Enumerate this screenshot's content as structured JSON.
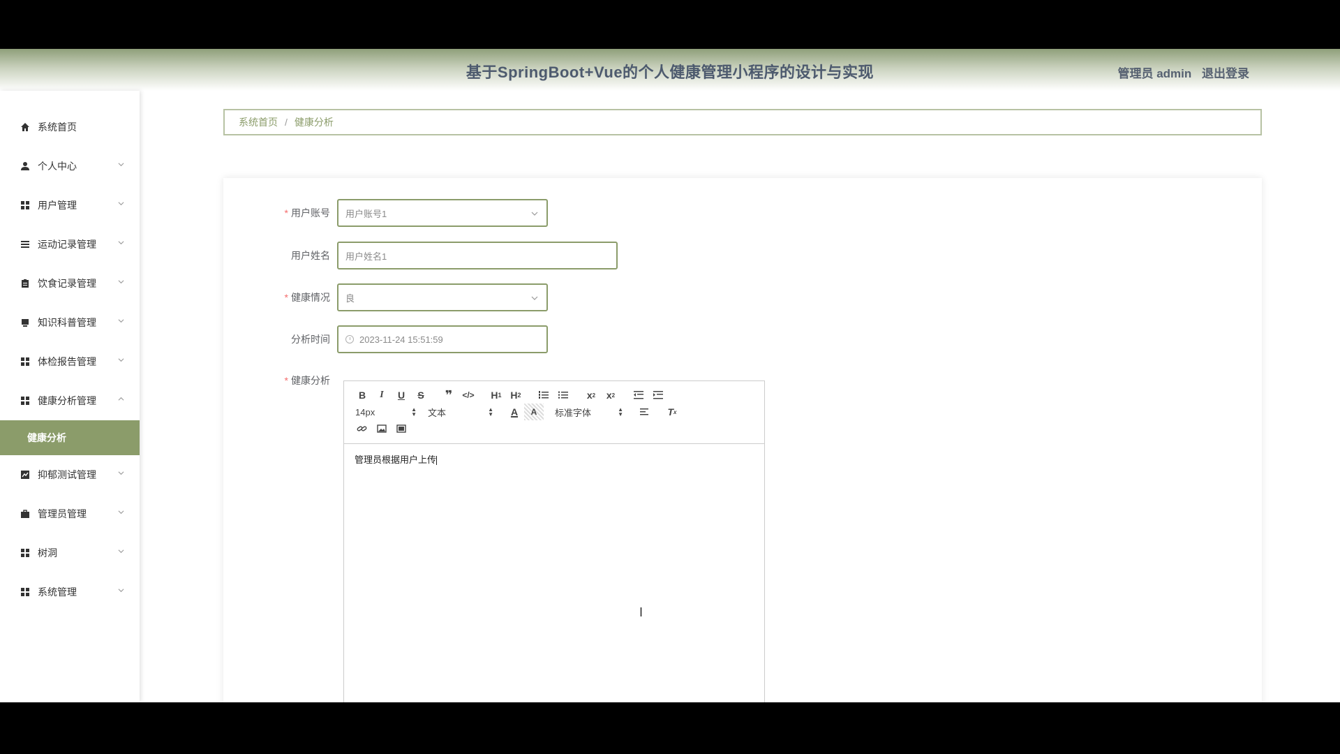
{
  "header": {
    "title": "基于SpringBoot+Vue的个人健康管理小程序的设计与实现",
    "user_label": "管理员 admin",
    "logout": "退出登录"
  },
  "sidebar": {
    "items": [
      {
        "label": "系统首页",
        "icon": "home-icon"
      },
      {
        "label": "个人中心",
        "icon": "user-icon"
      },
      {
        "label": "用户管理",
        "icon": "grid-icon"
      },
      {
        "label": "运动记录管理",
        "icon": "list-icon"
      },
      {
        "label": "饮食记录管理",
        "icon": "clipboard-icon"
      },
      {
        "label": "知识科普管理",
        "icon": "monitor-icon"
      },
      {
        "label": "体检报告管理",
        "icon": "grid-icon"
      },
      {
        "label": "健康分析管理",
        "icon": "grid-icon"
      },
      {
        "label": "抑郁测试管理",
        "icon": "chart-icon"
      },
      {
        "label": "管理员管理",
        "icon": "briefcase-icon"
      },
      {
        "label": "树洞",
        "icon": "grid-icon"
      },
      {
        "label": "系统管理",
        "icon": "grid-icon"
      }
    ],
    "sub_item": "健康分析"
  },
  "breadcrumb": {
    "home": "系统首页",
    "separator": "/",
    "current": "健康分析"
  },
  "form": {
    "account_label": "用户账号",
    "account_value": "用户账号1",
    "name_label": "用户姓名",
    "name_value": "用户姓名1",
    "health_label": "健康情况",
    "health_value": "良",
    "time_label": "分析时间",
    "time_value": "2023-11-24 15:51:59",
    "analysis_label": "健康分析"
  },
  "editor": {
    "font_size": "14px",
    "header_select": "文本",
    "font_family": "标准字体",
    "content": "管理员根据用户上传"
  },
  "colors": {
    "accent": "#8b9c6a",
    "required": "#f56c6c"
  }
}
